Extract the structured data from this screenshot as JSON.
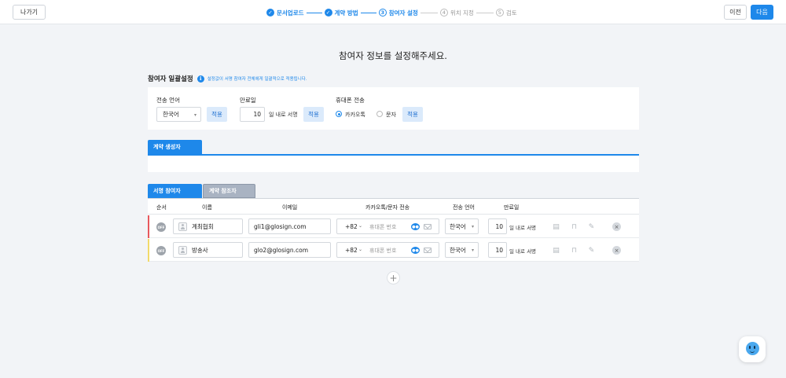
{
  "header": {
    "exit_label": "나가기",
    "prev_label": "이전",
    "next_label": "다음",
    "steps": [
      {
        "num": "1",
        "label": "문서업로드",
        "state": "done"
      },
      {
        "num": "2",
        "label": "계약 방법",
        "state": "done"
      },
      {
        "num": "3",
        "label": "참여자 설정",
        "state": "current"
      },
      {
        "num": "4",
        "label": "위치 지정",
        "state": "todo"
      },
      {
        "num": "5",
        "label": "검토",
        "state": "todo"
      }
    ]
  },
  "page_title": "참여자 정보를 설정해주세요.",
  "batch": {
    "title": "참여자 일괄설정",
    "info": "설정값이 서명 참여자 전체에게 일괄적으로 적용됩니다.",
    "language_label": "전송 언어",
    "language_value": "한국어",
    "apply_label": "적용",
    "expiry_label": "만료일",
    "expiry_value": "10",
    "expiry_suffix": "일 내로 서명",
    "phone_label": "휴대폰 전송",
    "radio_kakao": "카카오톡",
    "radio_sms": "문자"
  },
  "tabs": {
    "creator": "계약 생성자",
    "signer": "서명 참여자",
    "reference": "계약 참조자"
  },
  "table": {
    "headers": {
      "order": "순서",
      "name": "이름",
      "email": "이메일",
      "send": "카카오톡/문자 전송",
      "language": "전송 언어",
      "expiry": "만료일"
    },
    "rows": [
      {
        "toggle": "OFF",
        "name": "계최협회",
        "email": "gli1@glosign.com",
        "country_code": "+82",
        "phone_placeholder": "휴대폰 번호",
        "language": "한국어",
        "expiry": "10",
        "expiry_suffix": "일 내로 서명",
        "color": "#e8585d"
      },
      {
        "toggle": "OFF",
        "name": "방송사",
        "email": "glo2@glosign.com",
        "country_code": "+82",
        "phone_placeholder": "휴대폰 번호",
        "language": "한국어",
        "expiry": "10",
        "expiry_suffix": "일 내로 서명",
        "color": "#f2da6a"
      }
    ]
  },
  "colors": {
    "accent": "#1e88ea"
  }
}
